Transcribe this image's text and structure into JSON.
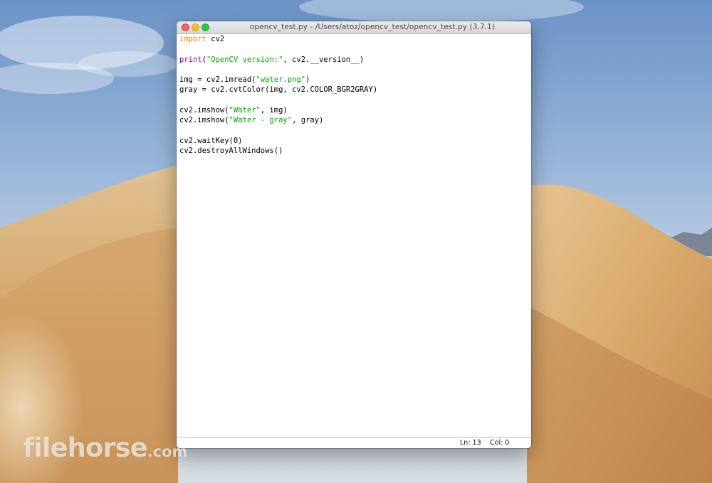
{
  "window": {
    "title": "opencv_test.py - /Users/atoz/opencv_test/opencv_test.py (3.7.1)"
  },
  "code": {
    "lines": [
      [
        {
          "t": "import",
          "k": "kw"
        },
        {
          "t": " cv2",
          "k": "plain"
        }
      ],
      [],
      [
        {
          "t": "print",
          "k": "bi"
        },
        {
          "t": "(",
          "k": "plain"
        },
        {
          "t": "\"OpenCV version:\"",
          "k": "str"
        },
        {
          "t": ", cv2.__version__)",
          "k": "plain"
        }
      ],
      [],
      [
        {
          "t": "img = cv2.imread(",
          "k": "plain"
        },
        {
          "t": "\"water.png\"",
          "k": "str"
        },
        {
          "t": ")",
          "k": "plain"
        }
      ],
      [
        {
          "t": "gray = cv2.cvtColor(img, cv2.COLOR_BGR2GRAY)",
          "k": "plain"
        }
      ],
      [],
      [
        {
          "t": "cv2.imshow(",
          "k": "plain"
        },
        {
          "t": "\"Water\"",
          "k": "str"
        },
        {
          "t": ", img)",
          "k": "plain"
        }
      ],
      [
        {
          "t": "cv2.imshow(",
          "k": "plain"
        },
        {
          "t": "\"Water - gray\"",
          "k": "str"
        },
        {
          "t": ", gray)",
          "k": "plain"
        }
      ],
      [],
      [
        {
          "t": "cv2.waitKey(0)",
          "k": "plain"
        }
      ],
      [
        {
          "t": "cv2.destroyAllWindows()",
          "k": "plain"
        }
      ]
    ]
  },
  "status": {
    "line": "Ln: 13",
    "col": "Col: 0"
  },
  "watermark": {
    "brand": "filehorse",
    "suffix": ".com"
  },
  "colors": {
    "keyword": "#ff7700",
    "builtin": "#900090",
    "string": "#00aa00",
    "close": "#fc5f57",
    "minimize": "#fdbc2e",
    "maximize": "#2ac840"
  }
}
